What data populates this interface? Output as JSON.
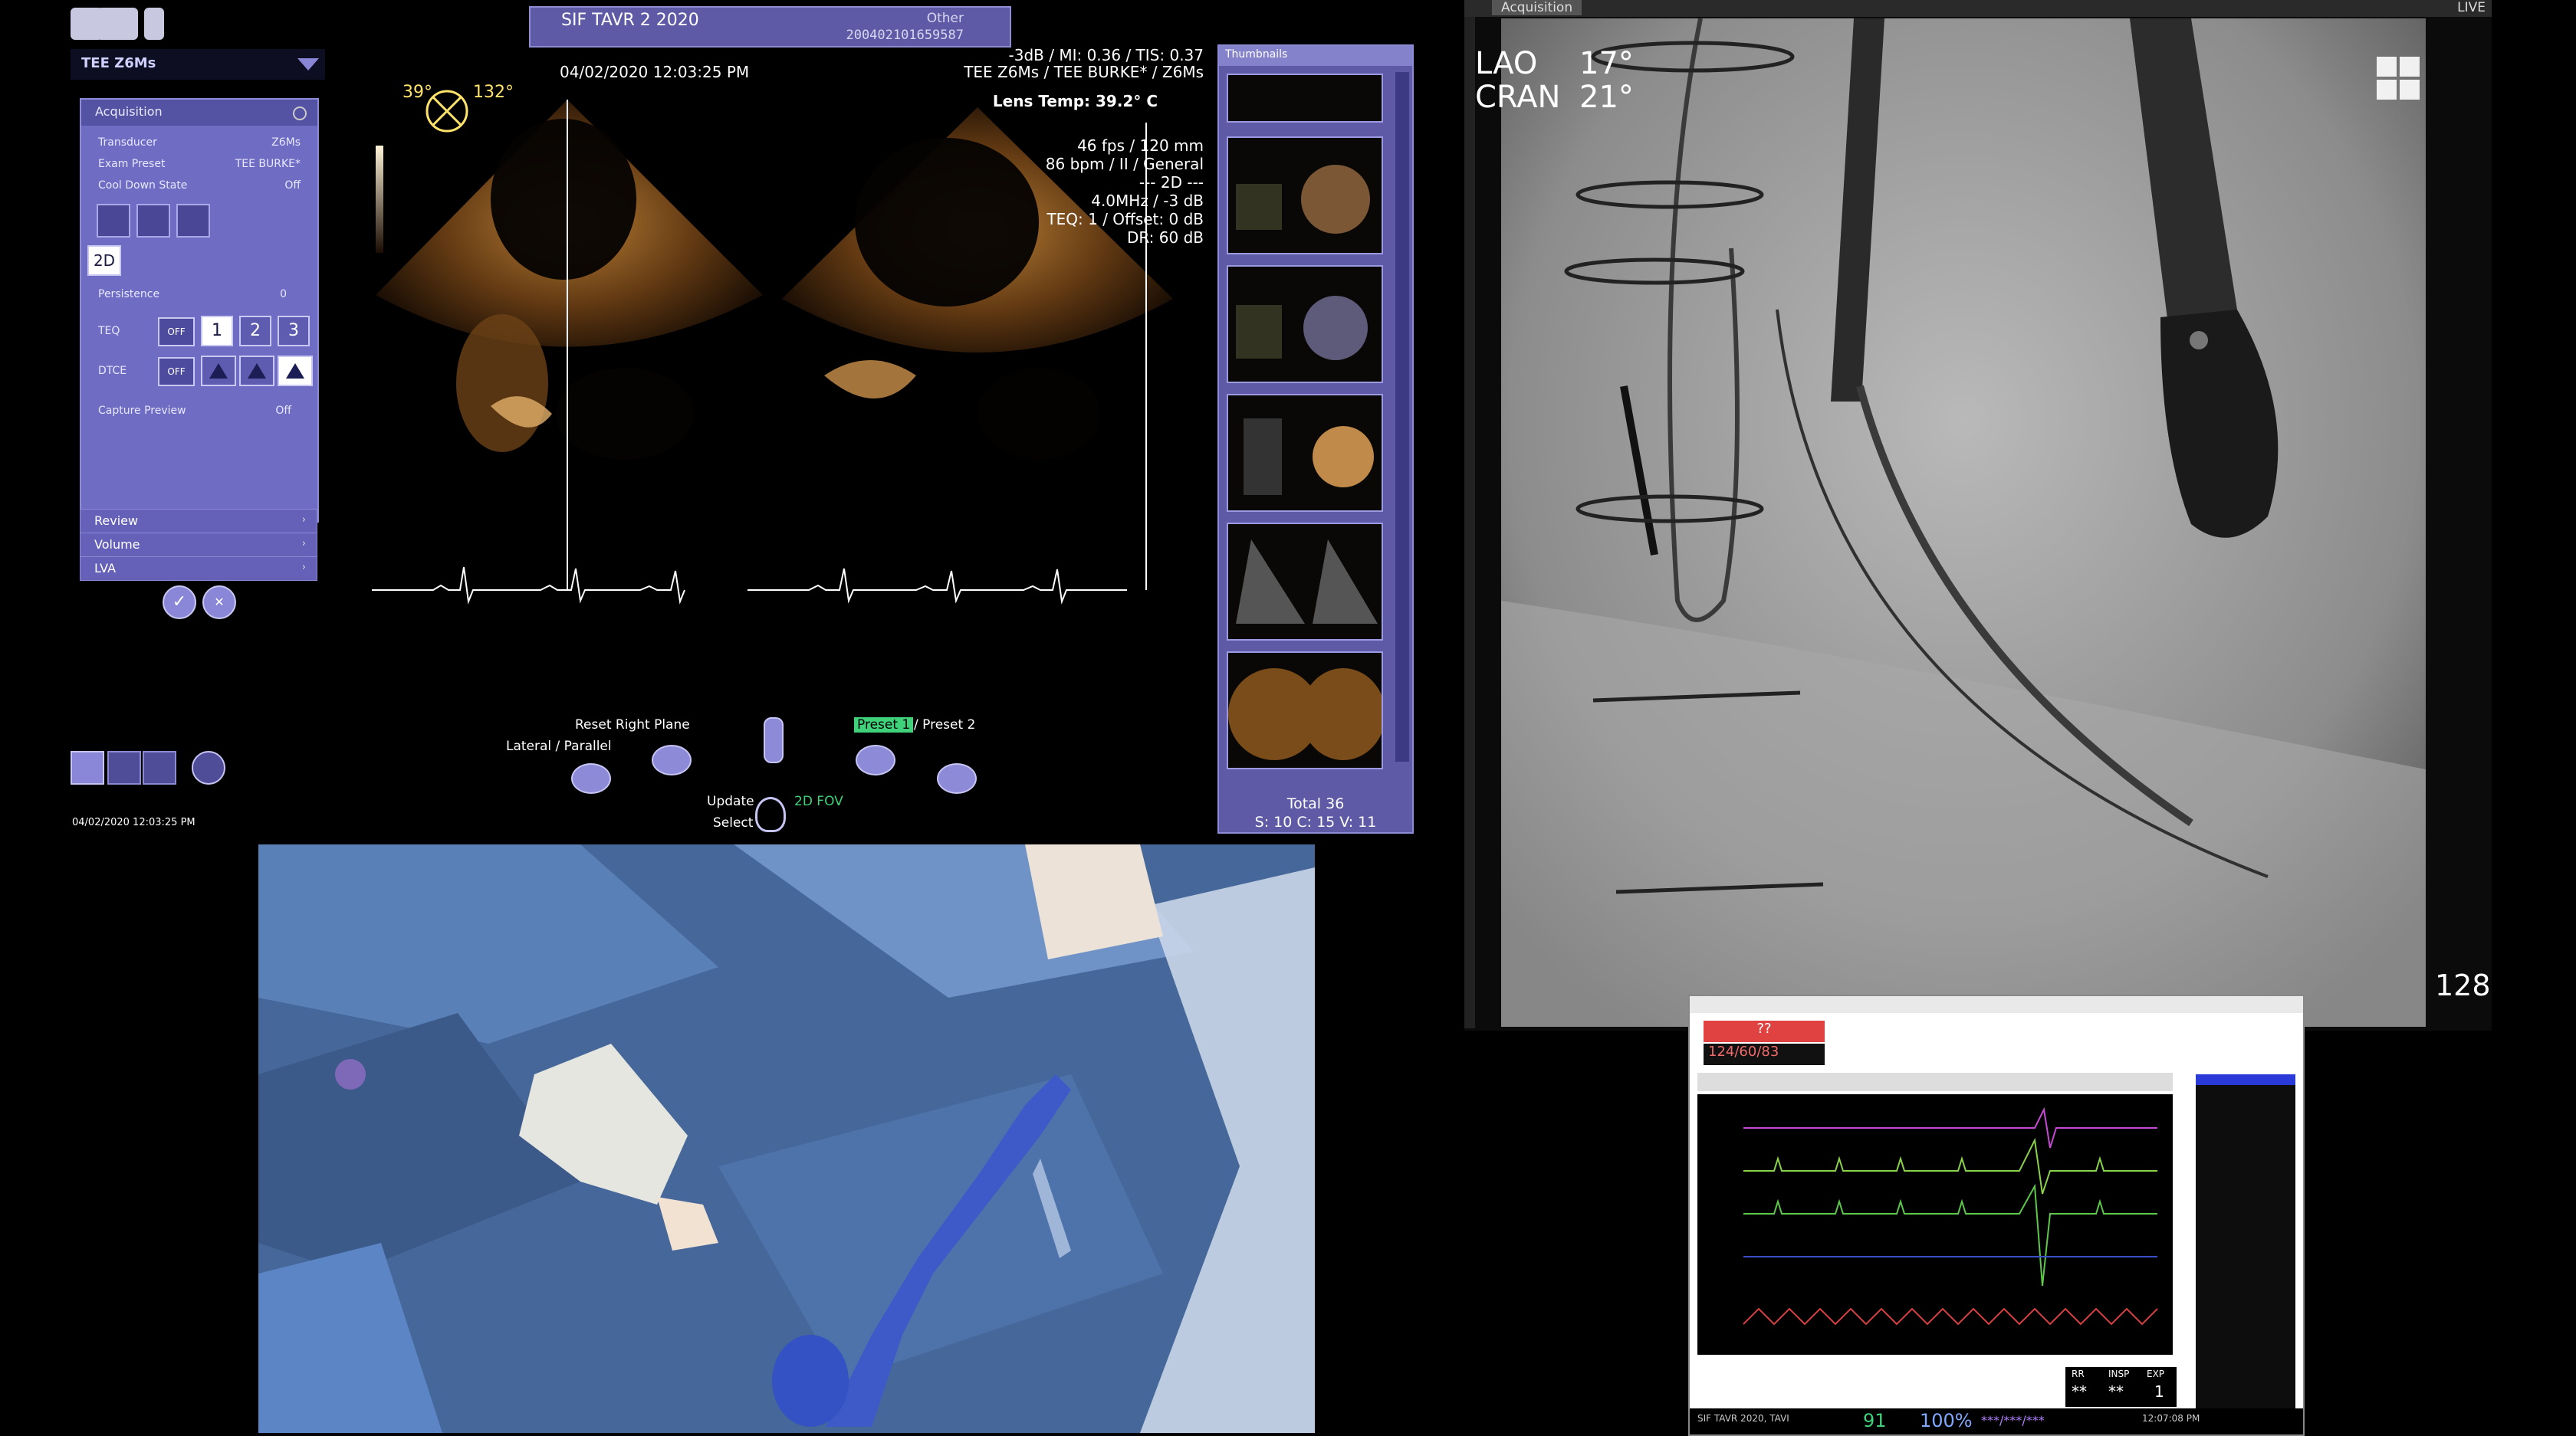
{
  "us": {
    "study_title": "SIF TAVR 2 2020",
    "study_other": "Other",
    "study_id": "200402101659587",
    "probe": "TEE Z6Ms",
    "acquisition": {
      "header": "Acquisition",
      "rows": [
        {
          "label": "Transducer",
          "value": "Z6Ms"
        },
        {
          "label": "Exam Preset",
          "value": "TEE BURKE*"
        },
        {
          "label": "Cool Down State",
          "value": "Off"
        }
      ],
      "mode_label": "2D",
      "persistence_label": "Persistence",
      "persistence_value": "0",
      "teq_label": "TEQ",
      "dtce_label": "DTCE",
      "off_label": "OFF",
      "teq_options": [
        "1",
        "2",
        "3"
      ],
      "capture_label": "Capture Preview",
      "capture_value": "Off"
    },
    "accordion": [
      "Review",
      "Volume",
      "LVA"
    ],
    "accept_icon": "✓",
    "cancel_icon": "✕",
    "bottom_timestamp": "04/02/2020 12:03:25 PM",
    "image": {
      "timestamp": "04/02/2020 12:03:25 PM",
      "indices": "-3dB / MI: 0.36 / TIS: 0.37",
      "probe_preset": "TEE Z6Ms / TEE BURKE* / Z6Ms",
      "lens_temp": "Lens Temp: 39.2° C",
      "angle_left": "39°",
      "angle_right": "132°",
      "params": [
        "46 fps / 120 mm",
        "86 bpm / II / General",
        "--- 2D ---",
        "4.0MHz / -3 dB",
        "TEQ: 1 / Offset: 0 dB",
        "DR: 60 dB"
      ]
    },
    "thumbs": {
      "header": "Thumbnails",
      "total": "Total   36",
      "counts": "S: 10 C: 15 V: 11"
    },
    "controls": {
      "reset": "Reset Right Plane",
      "lateral": "Lateral / Parallel",
      "preset1": "Preset 1",
      "preset2": "/ Preset 2",
      "update": "Update",
      "select": "Select",
      "fov": "2D FOV"
    }
  },
  "fluoro": {
    "tab": "Acquisition",
    "live": "LIVE",
    "lao_label": "LAO",
    "lao_value": "17°",
    "cran_label": "CRAN",
    "cran_value": "21°",
    "frame": "128"
  },
  "hemo": {
    "alarm": "??",
    "bp": "124/60/83",
    "resp_labels": [
      "RR",
      "INSP",
      "EXP"
    ],
    "resp_values": [
      "**",
      "**",
      "1"
    ],
    "status_left": "SIF TAVR 2020, TAVI",
    "status_green": "91",
    "status_pct": "100%",
    "status_dash": "***/***/***",
    "status_time": "12:07:08 PM"
  },
  "colors": {
    "panel": "#6f6cc3",
    "panel_dark": "#5452a2",
    "preset_green": "#3fd27a"
  }
}
